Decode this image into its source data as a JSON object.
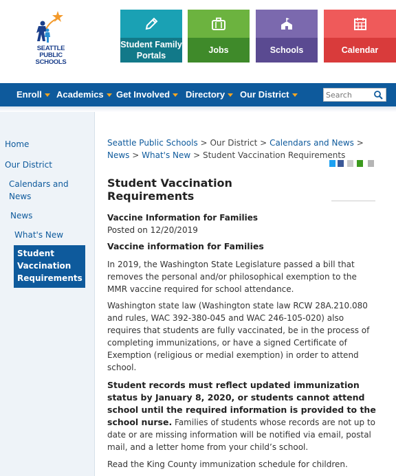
{
  "colors": {
    "nav_bg": "#0e5a9c",
    "caret": "#f5a623",
    "tile_portals": "#1aa1b4",
    "tile_jobs": "#6cb33f",
    "tile_schools": "#7b69ae",
    "tile_calendar": "#ef5a5a",
    "link": "#0e5a9c"
  },
  "logo": {
    "lines": [
      "SEATTLE",
      "PUBLIC",
      "SCHOOLS"
    ],
    "icon": "school-logo-icon"
  },
  "tiles": [
    {
      "label": "Student Family Portals",
      "icon": "pencil-icon"
    },
    {
      "label": "Jobs",
      "icon": "briefcase-icon"
    },
    {
      "label": "Schools",
      "icon": "school-building-icon"
    },
    {
      "label": "Calendar",
      "icon": "calendar-icon"
    }
  ],
  "nav": {
    "items": [
      "Enroll",
      "Academics",
      "Get Involved",
      "Directory",
      "Our District"
    ],
    "search_placeholder": "Search",
    "search_icon": "search-icon"
  },
  "sidebar": {
    "items": [
      "Home",
      "Our District",
      "Calendars and News",
      "News",
      "What's New"
    ],
    "active": "Student Vaccination Requirements"
  },
  "breadcrumb": {
    "items": [
      "Seattle Public Schools",
      "Our District",
      "Calendars and News",
      "News",
      "What's New",
      "Student Vaccination Requirements"
    ],
    "separator": ">"
  },
  "share_icons": [
    "facebook-icon",
    "twitter-icon",
    "email-icon",
    "share-icon",
    "print-icon"
  ],
  "page": {
    "title": "Student Vaccination Requirements",
    "article_heading": "Vaccine Information for Families",
    "posted": "Posted on 12/20/2019",
    "subheading": "Vaccine information for Families",
    "para1": "In 2019, the Washington State Legislature passed a bill that removes the personal and/or philosophical exemption to the MMR vaccine required for school attendance.",
    "para2": "Washington state law (Washington state law RCW 28A.210.080 and rules, WAC 392-380-045 and WAC 246-105-020) also requires that students are fully vaccinated, be in the process of completing immunizations, or have a signed Certificate of Exemption (religious or medial exemption) in order to attend school.",
    "para3_bold": "Student records must reflect updated immunization status by January 8, 2020, or students cannot attend school until the required information is provided to the school nurse.",
    "para3_rest": " Families of students whose records are not up to date or are missing information will be notified via email, postal mail, and a letter home from your child’s school.",
    "link": "Read the King County immunization schedule for children."
  }
}
